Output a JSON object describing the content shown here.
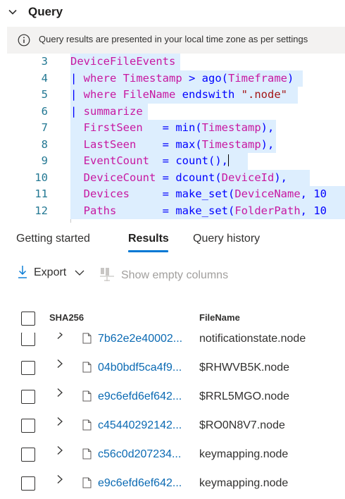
{
  "query": {
    "title": "Query",
    "info": "Query results are presented in your local time zone as per settings"
  },
  "editor": {
    "lines": [
      {
        "num": "3",
        "parts": [
          {
            "t": "DeviceFileEvents",
            "c": "var"
          }
        ]
      },
      {
        "num": "4",
        "parts": [
          {
            "t": "| ",
            "c": "pipe"
          },
          {
            "t": "where ",
            "c": "kw"
          },
          {
            "t": "Timestamp",
            "c": "var"
          },
          {
            "t": " > ",
            "c": "op"
          },
          {
            "t": "ago",
            "c": "fn"
          },
          {
            "t": "(",
            "c": "op"
          },
          {
            "t": "Timeframe",
            "c": "var"
          },
          {
            "t": ")",
            "c": "op"
          }
        ]
      },
      {
        "num": "5",
        "parts": [
          {
            "t": "| ",
            "c": "pipe"
          },
          {
            "t": "where ",
            "c": "kw"
          },
          {
            "t": "FileName",
            "c": "var"
          },
          {
            "t": " endswith ",
            "c": "op"
          },
          {
            "t": "\".node\"",
            "c": "str"
          }
        ]
      },
      {
        "num": "6",
        "parts": [
          {
            "t": "| ",
            "c": "pipe"
          },
          {
            "t": "summarize",
            "c": "kw"
          }
        ]
      },
      {
        "num": "7",
        "parts": [
          {
            "t": "  FirstSeen   ",
            "c": "var"
          },
          {
            "t": "= ",
            "c": "op"
          },
          {
            "t": "min",
            "c": "fn"
          },
          {
            "t": "(",
            "c": "op"
          },
          {
            "t": "Timestamp",
            "c": "var"
          },
          {
            "t": "),",
            "c": "op"
          }
        ]
      },
      {
        "num": "8",
        "parts": [
          {
            "t": "  LastSeen    ",
            "c": "var"
          },
          {
            "t": "= ",
            "c": "op"
          },
          {
            "t": "max",
            "c": "fn"
          },
          {
            "t": "(",
            "c": "op"
          },
          {
            "t": "Timestamp",
            "c": "var"
          },
          {
            "t": "),",
            "c": "op"
          }
        ]
      },
      {
        "num": "9",
        "parts": [
          {
            "t": "  EventCount  ",
            "c": "var"
          },
          {
            "t": "= ",
            "c": "op"
          },
          {
            "t": "count",
            "c": "fn"
          },
          {
            "t": "(),",
            "c": "op"
          }
        ],
        "cursor": true
      },
      {
        "num": "10",
        "parts": [
          {
            "t": "  DeviceCount ",
            "c": "var"
          },
          {
            "t": "= ",
            "c": "op"
          },
          {
            "t": "dcount",
            "c": "fn"
          },
          {
            "t": "(",
            "c": "op"
          },
          {
            "t": "DeviceId",
            "c": "var"
          },
          {
            "t": "),",
            "c": "op"
          }
        ]
      },
      {
        "num": "11",
        "parts": [
          {
            "t": "  Devices     ",
            "c": "var"
          },
          {
            "t": "= ",
            "c": "op"
          },
          {
            "t": "make_set",
            "c": "fn"
          },
          {
            "t": "(",
            "c": "op"
          },
          {
            "t": "DeviceName",
            "c": "var"
          },
          {
            "t": ", 10",
            "c": "op"
          }
        ]
      },
      {
        "num": "12",
        "parts": [
          {
            "t": "  Paths       ",
            "c": "var"
          },
          {
            "t": "= ",
            "c": "op"
          },
          {
            "t": "make_set",
            "c": "fn"
          },
          {
            "t": "(",
            "c": "op"
          },
          {
            "t": "FolderPath",
            "c": "var"
          },
          {
            "t": ", 10",
            "c": "op"
          }
        ]
      }
    ]
  },
  "tabs": {
    "getting_started": "Getting started",
    "results": "Results",
    "query_history": "Query history"
  },
  "toolbar": {
    "export_label": "Export",
    "show_empty_label": "Show empty columns"
  },
  "table": {
    "headers": {
      "sha256": "SHA256",
      "filename": "FileName"
    },
    "rows": [
      {
        "sha": "7b62e2e40002...",
        "file": "notificationstate.node"
      },
      {
        "sha": "04b0bdf5ca4f9...",
        "file": "$RHWVB5K.node"
      },
      {
        "sha": "e9c6efd6ef642...",
        "file": "$RRL5MGO.node"
      },
      {
        "sha": "c45440292142...",
        "file": "$RO0N8V7.node"
      },
      {
        "sha": "c56c0d207234...",
        "file": "keymapping.node"
      },
      {
        "sha": "e9c6efd6ef642...",
        "file": "keymapping.node"
      }
    ]
  },
  "colors": {
    "accent": "#0078d4",
    "link": "#0b6ab3",
    "selection": "#ddeefe",
    "keyword": "#c718a1",
    "operator": "#0000ff",
    "string": "#a31515",
    "line_number": "#237893"
  }
}
